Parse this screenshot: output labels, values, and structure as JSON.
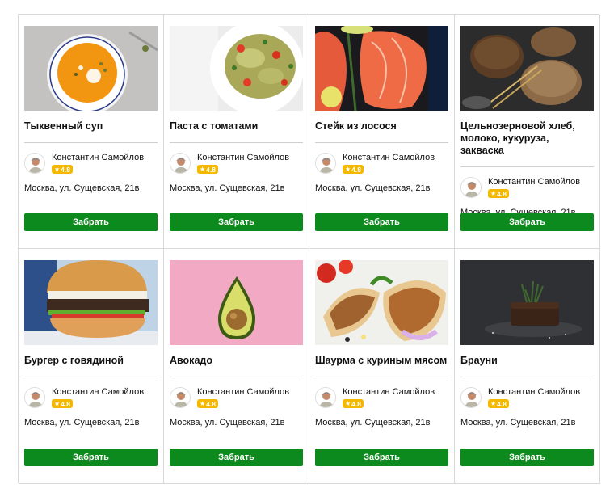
{
  "common": {
    "author_name": "Константин Самойлов",
    "rating": "4.8",
    "address": "Москва, ул. Сущевская, 21в",
    "button_label": "Забрать",
    "accent_color": "#0c8a1d",
    "rating_color": "#f5b800"
  },
  "cards": [
    {
      "title": "Тыквенный суп",
      "image": "pumpkin-soup"
    },
    {
      "title": "Паста с томатами",
      "image": "pasta-with-tomatoes"
    },
    {
      "title": "Стейк из лосося",
      "image": "salmon-steak"
    },
    {
      "title": "Цельнозерновой хлеб, молоко, кукуруза, закваска",
      "image": "whole-grain-bread"
    },
    {
      "title": "Бургер с говядиной",
      "image": "beef-burger"
    },
    {
      "title": "Авокадо",
      "image": "avocado"
    },
    {
      "title": "Шаурма с куриным мясом",
      "image": "chicken-shawarma"
    },
    {
      "title": "Брауни",
      "image": "brownie"
    }
  ]
}
